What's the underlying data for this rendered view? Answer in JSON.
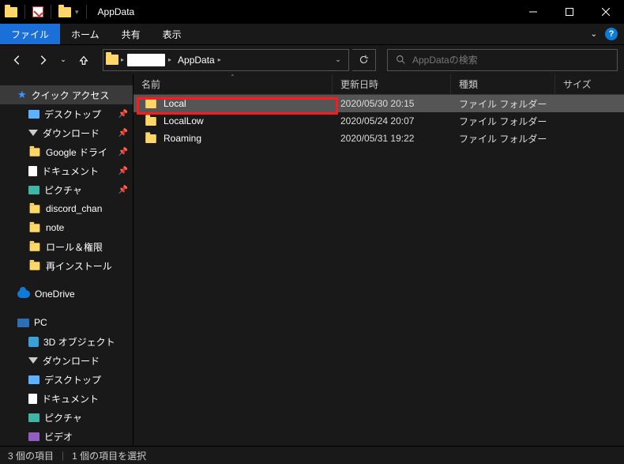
{
  "window": {
    "title": "AppData"
  },
  "ribbon": {
    "file": "ファイル",
    "home": "ホーム",
    "share": "共有",
    "view": "表示"
  },
  "breadcrumb": {
    "seg1": "",
    "seg2": "AppData"
  },
  "search": {
    "placeholder": "AppDataの検索"
  },
  "columns": {
    "name": "名前",
    "date": "更新日時",
    "type": "種類",
    "size": "サイズ"
  },
  "rows": [
    {
      "name": "Local",
      "date": "2020/05/30 20:15",
      "type": "ファイル フォルダー",
      "selected": true
    },
    {
      "name": "LocalLow",
      "date": "2020/05/24 20:07",
      "type": "ファイル フォルダー",
      "selected": false
    },
    {
      "name": "Roaming",
      "date": "2020/05/31 19:22",
      "type": "ファイル フォルダー",
      "selected": false
    }
  ],
  "sidebar": {
    "quick": "クイック アクセス",
    "desktop": "デスクトップ",
    "downloads": "ダウンロード",
    "gdrive": "Google ドライ",
    "documents": "ドキュメント",
    "pictures": "ピクチャ",
    "discord": "discord_chan",
    "note": "note",
    "roles": "ロール＆権限",
    "reinstall": "再インストール",
    "onedrive": "OneDrive",
    "pc": "PC",
    "obj3d": "3D オブジェクト",
    "downloads2": "ダウンロード",
    "desktop2": "デスクトップ",
    "documents2": "ドキュメント",
    "pictures2": "ピクチャ",
    "videos": "ビデオ"
  },
  "status": {
    "count": "3 個の項目",
    "selected": "1 個の項目を選択"
  }
}
